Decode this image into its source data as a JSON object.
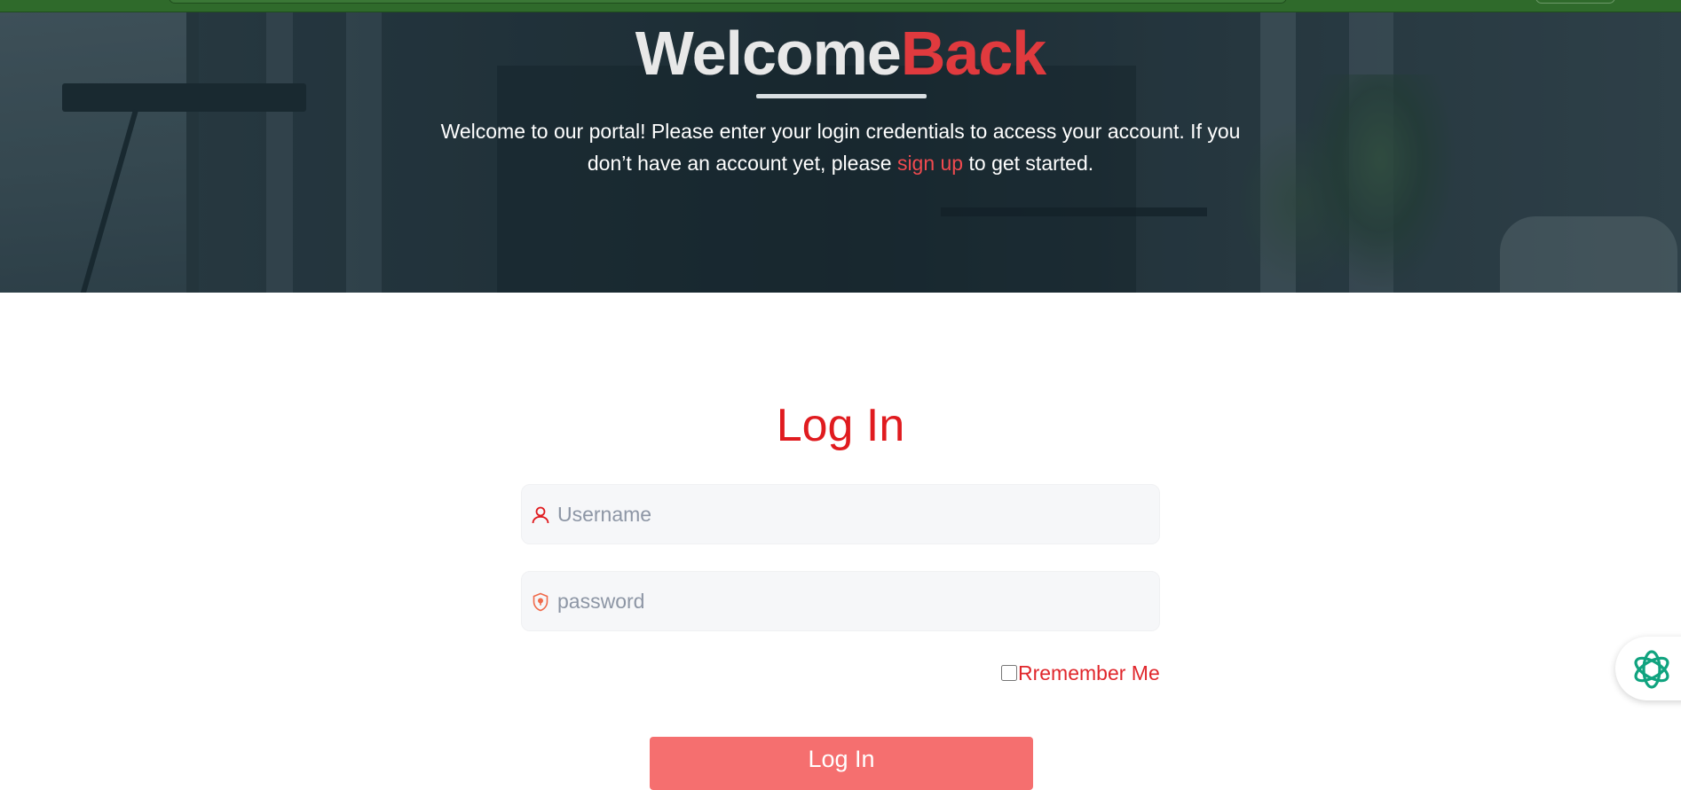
{
  "hero": {
    "title_part1": "Welcome",
    "title_part2": "Back",
    "text_before_link": "Welcome to our portal! Please enter your login credentials to access your account. If you don’t have an account yet, please ",
    "link_text": "sign up",
    "text_after_link": " to get started."
  },
  "login": {
    "title": "Log In",
    "username_placeholder": "Username",
    "password_placeholder": "password",
    "remember_label": "Rremember Me",
    "button_label": "Log In"
  },
  "icons": {
    "username": "user-icon",
    "password": "shield-lock-icon",
    "chat": "assistant-logo-icon"
  },
  "colors": {
    "accent_red": "#e01b1f",
    "button_bg": "#f56f6f",
    "topbar_green": "#2f6a2b",
    "chat_icon_green": "#10a37f"
  }
}
